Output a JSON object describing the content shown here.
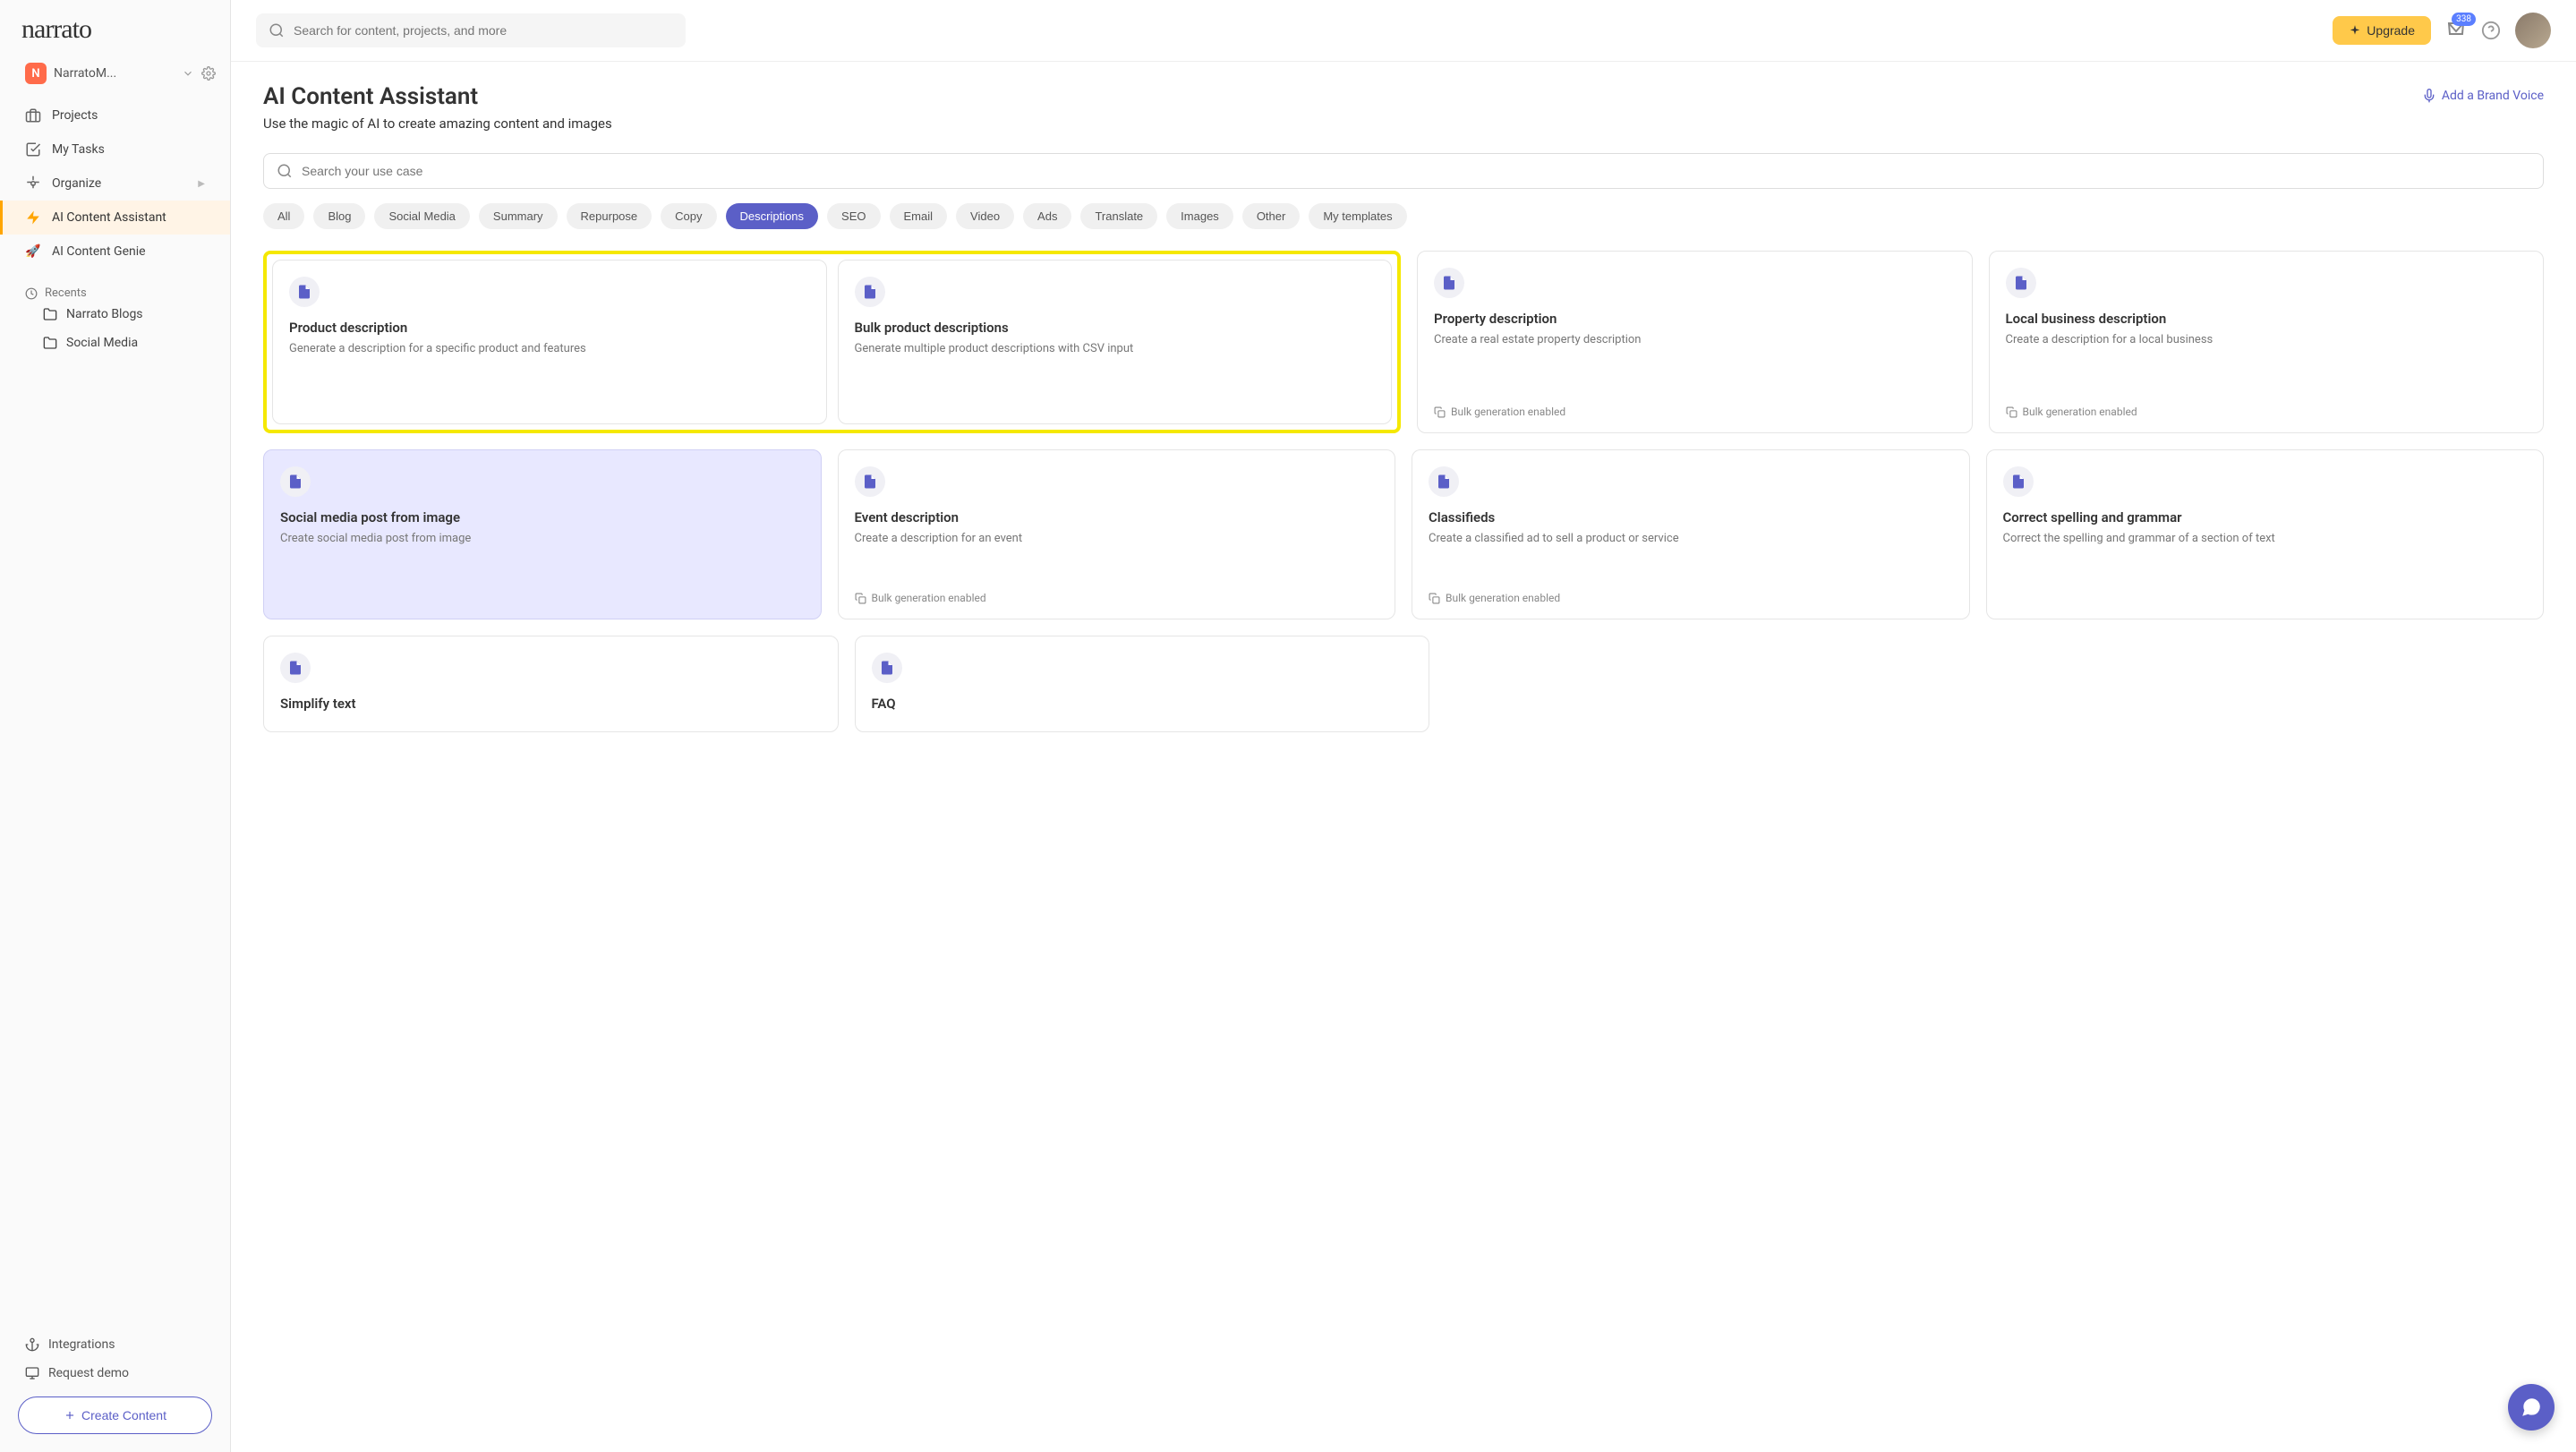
{
  "logo": "narrato",
  "workspace": {
    "badge": "N",
    "name": "NarratoM..."
  },
  "nav": {
    "projects": "Projects",
    "tasks": "My Tasks",
    "organize": "Organize",
    "assistant": "AI Content Assistant",
    "genie": "AI Content Genie"
  },
  "recents": {
    "header": "Recents",
    "items": [
      "Narrato Blogs",
      "Social Media"
    ]
  },
  "sidebar_bottom": {
    "integrations": "Integrations",
    "demo": "Request demo",
    "create": "Create Content"
  },
  "topbar": {
    "search_placeholder": "Search for content, projects, and more",
    "upgrade": "Upgrade",
    "inbox_count": "338"
  },
  "page": {
    "title": "AI Content Assistant",
    "subtitle": "Use the magic of AI to create amazing content and images",
    "brand_voice": "Add a Brand Voice",
    "usecase_placeholder": "Search your use case"
  },
  "filters": [
    "All",
    "Blog",
    "Social Media",
    "Summary",
    "Repurpose",
    "Copy",
    "Descriptions",
    "SEO",
    "Email",
    "Video",
    "Ads",
    "Translate",
    "Images",
    "Other",
    "My templates"
  ],
  "active_filter": "Descriptions",
  "bulk_label": "Bulk generation enabled",
  "cards": {
    "product": {
      "title": "Product description",
      "desc": "Generate a description for a specific product and features"
    },
    "bulk_product": {
      "title": "Bulk product descriptions",
      "desc": "Generate multiple product descriptions with CSV input"
    },
    "property": {
      "title": "Property description",
      "desc": "Create a real estate property description"
    },
    "local_biz": {
      "title": "Local business description",
      "desc": "Create a description for a local business"
    },
    "social_img": {
      "title": "Social media post from image",
      "desc": "Create social media post from image"
    },
    "event": {
      "title": "Event description",
      "desc": "Create a description for an event"
    },
    "classifieds": {
      "title": "Classifieds",
      "desc": "Create a classified ad to sell a product or service"
    },
    "grammar": {
      "title": "Correct spelling and grammar",
      "desc": "Correct the spelling and grammar of a section of text"
    },
    "simplify": {
      "title": "Simplify text",
      "desc": ""
    },
    "faq": {
      "title": "FAQ",
      "desc": ""
    }
  }
}
